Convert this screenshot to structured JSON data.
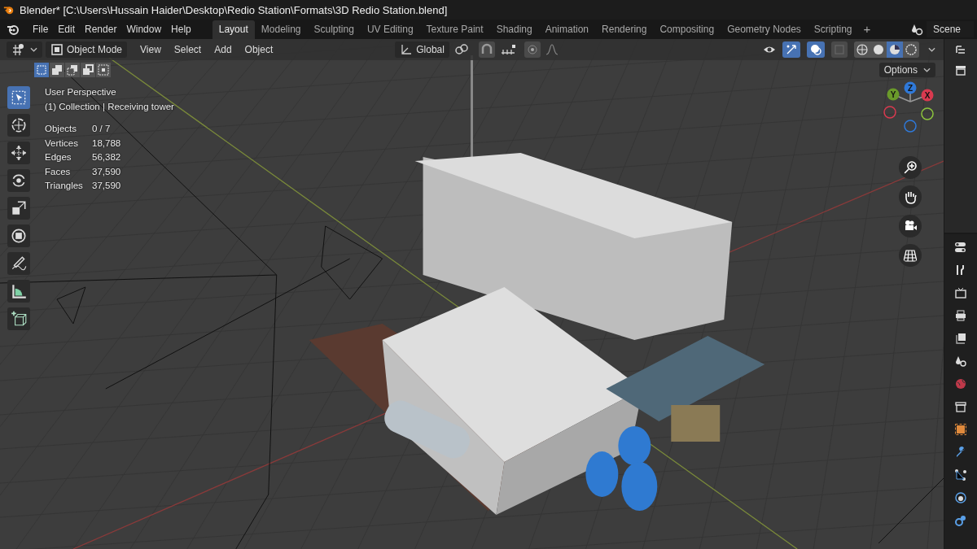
{
  "window": {
    "title": "Blender* [C:\\Users\\Hussain Haider\\Desktop\\Redio Station\\Formats\\3D Redio Station.blend]"
  },
  "menu": [
    "File",
    "Edit",
    "Render",
    "Window",
    "Help"
  ],
  "workspaces": [
    {
      "label": "Layout",
      "selected": true
    },
    {
      "label": "Modeling",
      "selected": false
    },
    {
      "label": "Sculpting",
      "selected": false
    },
    {
      "label": "UV Editing",
      "selected": false
    },
    {
      "label": "Texture Paint",
      "selected": false
    },
    {
      "label": "Shading",
      "selected": false
    },
    {
      "label": "Animation",
      "selected": false
    },
    {
      "label": "Rendering",
      "selected": false
    },
    {
      "label": "Compositing",
      "selected": false
    },
    {
      "label": "Geometry Nodes",
      "selected": false
    },
    {
      "label": "Scripting",
      "selected": false
    }
  ],
  "add_workspace": "+",
  "scene": "Scene",
  "viewport_header": {
    "mode": "Object Mode",
    "menus": [
      "View",
      "Select",
      "Add",
      "Object"
    ],
    "orientation": "Global",
    "gizmos_on": true,
    "overlays_on": true,
    "shading": [
      {
        "kind": "wireframe",
        "selected": false
      },
      {
        "kind": "solid",
        "selected": false
      },
      {
        "kind": "material",
        "selected": true
      },
      {
        "kind": "rendered",
        "selected": false
      }
    ]
  },
  "select_modes": [
    {
      "kind": "new",
      "selected": true
    },
    {
      "kind": "extend",
      "selected": false
    },
    {
      "kind": "subtract",
      "selected": false
    },
    {
      "kind": "invert",
      "selected": false
    },
    {
      "kind": "intersect",
      "selected": false
    }
  ],
  "options": "Options",
  "tools": [
    {
      "kind": "select",
      "selected": true
    },
    {
      "kind": "cursor",
      "selected": false
    },
    {
      "kind": "move",
      "selected": false
    },
    {
      "kind": "rotate",
      "selected": false
    },
    {
      "kind": "scale",
      "selected": false
    },
    {
      "kind": "transform",
      "selected": false
    },
    {
      "kind": "annotate",
      "selected": false
    },
    {
      "kind": "measure",
      "selected": false
    },
    {
      "kind": "add-cube",
      "selected": false
    }
  ],
  "overlay": {
    "view": "User Perspective",
    "collection": "(1) Collection | Receiving tower",
    "stats": [
      {
        "label": "Objects",
        "value": "0 / 7"
      },
      {
        "label": "Vertices",
        "value": "18,788"
      },
      {
        "label": "Edges",
        "value": "56,382"
      },
      {
        "label": "Faces",
        "value": "37,590"
      },
      {
        "label": "Triangles",
        "value": "37,590"
      }
    ]
  },
  "gizmo_axes": [
    {
      "label": "Z",
      "color": "#2f79d9"
    },
    {
      "label": "Y",
      "color": "#6a9a2a"
    },
    {
      "label": "X",
      "color": "#d93a4f"
    }
  ]
}
